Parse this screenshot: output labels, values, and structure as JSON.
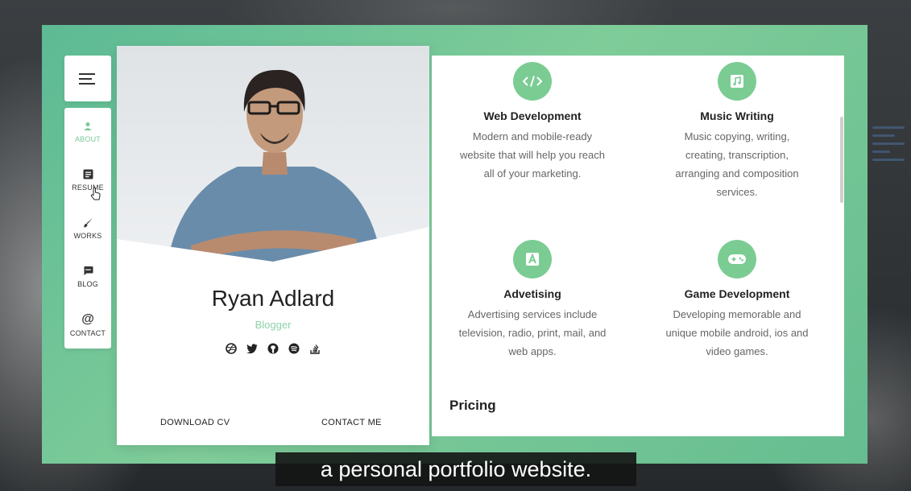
{
  "nav": {
    "items": [
      {
        "label": "ABOUT",
        "icon": "person-icon",
        "active": true
      },
      {
        "label": "RESUME",
        "icon": "document-icon",
        "active": false
      },
      {
        "label": "WORKS",
        "icon": "brush-icon",
        "active": false
      },
      {
        "label": "BLOG",
        "icon": "chat-icon",
        "active": false
      },
      {
        "label": "CONTACT",
        "icon": "at-icon",
        "active": false
      }
    ]
  },
  "profile": {
    "name": "Ryan Adlard",
    "subtitle": "Blogger",
    "socials": [
      "dribbble-icon",
      "twitter-icon",
      "github-icon",
      "spotify-icon",
      "stackoverflow-icon"
    ],
    "download_cv": "DOWNLOAD CV",
    "contact_me": "CONTACT ME"
  },
  "services": [
    {
      "title": "Web Development",
      "desc": [
        "Modern and mobile-ready",
        "website that will help you reach",
        "all of your marketing."
      ],
      "icon": "code-icon"
    },
    {
      "title": "Music Writing",
      "desc": [
        "Music copying, writing,",
        "creating, transcription,",
        "arranging and composition",
        "services."
      ],
      "icon": "music-icon"
    },
    {
      "title": "Advetising",
      "desc": [
        "Advertising services include",
        "television, radio, print, mail, and",
        "web apps."
      ],
      "icon": "ad-icon"
    },
    {
      "title": "Game Development",
      "desc": [
        "Developing memorable and",
        "unique mobile android, ios and",
        "video games."
      ],
      "icon": "gamepad-icon"
    }
  ],
  "pricing_heading": "Pricing",
  "caption": "a personal portfolio website.",
  "colors": {
    "accent": "#7bcc93",
    "frame": "#6ec496",
    "subtitle": "#8fd1aa"
  }
}
